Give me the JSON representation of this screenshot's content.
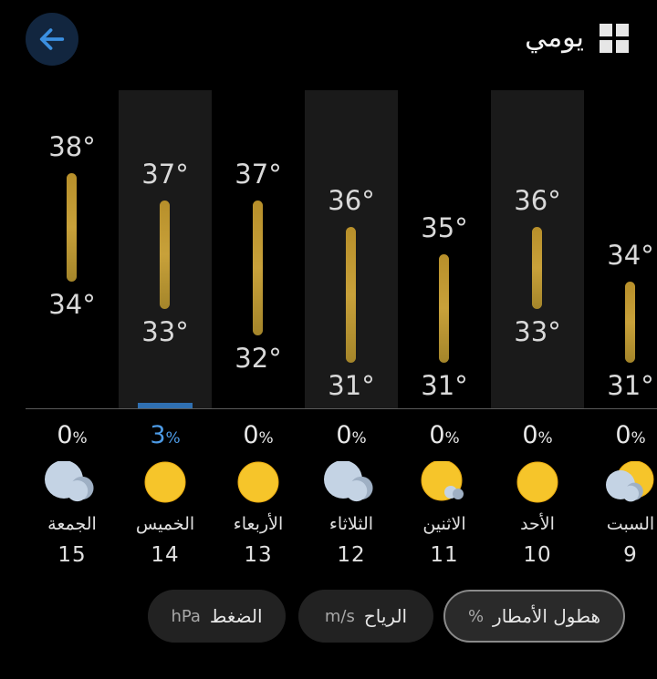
{
  "header": {
    "title": "يومي",
    "back_icon": "arrow-left-icon",
    "view_icon": "grid-icon"
  },
  "colors": {
    "accent_blue": "#4d9be6",
    "bar_gold": "#c8a13a",
    "background": "#000000"
  },
  "days": [
    {
      "name": "الجمعة",
      "num": "15",
      "high": "38°",
      "low": "34°",
      "precip": "0",
      "icon": "cloudy-icon"
    },
    {
      "name": "الخميس",
      "num": "14",
      "high": "37°",
      "low": "33°",
      "precip": "3",
      "icon": "sun-icon"
    },
    {
      "name": "الأربعاء",
      "num": "13",
      "high": "37°",
      "low": "32°",
      "precip": "0",
      "icon": "sun-icon"
    },
    {
      "name": "الثلاثاء",
      "num": "12",
      "high": "36°",
      "low": "31°",
      "precip": "0",
      "icon": "cloudy-icon"
    },
    {
      "name": "الاثنين",
      "num": "11",
      "high": "35°",
      "low": "31°",
      "precip": "0",
      "icon": "mostly-sunny-icon"
    },
    {
      "name": "الأحد",
      "num": "10",
      "high": "36°",
      "low": "33°",
      "precip": "0",
      "icon": "sun-icon"
    },
    {
      "name": "السبت",
      "num": "9",
      "high": "34°",
      "low": "31°",
      "precip": "0",
      "icon": "partly-cloudy-icon"
    }
  ],
  "precip_unit": "%",
  "selected_day_rain": {
    "day": "14",
    "value": 3
  },
  "metrics": [
    {
      "label": "هطول الأمطار",
      "unit": "%",
      "active": true
    },
    {
      "label": "الرياح",
      "unit": "m/s",
      "active": false
    },
    {
      "label": "الضغط",
      "unit": "hPa",
      "active": false
    }
  ]
}
